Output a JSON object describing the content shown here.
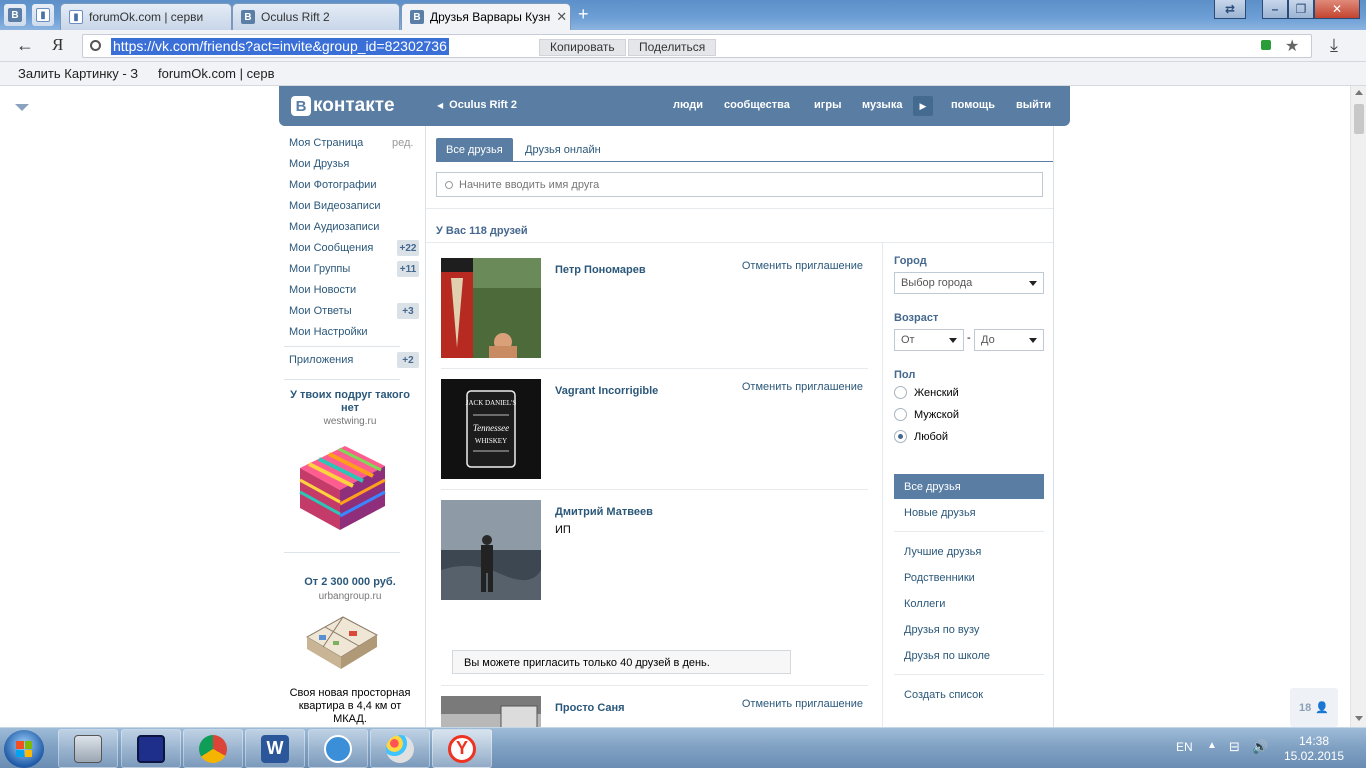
{
  "browser": {
    "tabs": [
      {
        "title": "forumOk.com | серви"
      },
      {
        "title": "Oculus Rift 2"
      },
      {
        "title": "Друзья Варвары Кузн"
      }
    ],
    "url": "https://vk.com/friends?act=invite&group_id=82302736",
    "copy_label": "Копировать",
    "share_label": "Поделиться",
    "bookmarks": [
      "Залить Картинку - З",
      "forumOk.com | серв"
    ]
  },
  "vk": {
    "logo": "контакте",
    "back_link": "Oculus Rift 2",
    "nav": [
      "люди",
      "сообщества",
      "игры",
      "музыка",
      "помощь",
      "выйти"
    ]
  },
  "sidebar": {
    "items": [
      {
        "label": "Моя Страница",
        "extra": "ред."
      },
      {
        "label": "Мои Друзья"
      },
      {
        "label": "Мои Фотографии"
      },
      {
        "label": "Мои Видеозаписи"
      },
      {
        "label": "Мои Аудиозаписи"
      },
      {
        "label": "Мои Сообщения",
        "count": "+22"
      },
      {
        "label": "Мои Группы",
        "count": "+11"
      },
      {
        "label": "Мои Новости"
      },
      {
        "label": "Мои Ответы",
        "count": "+3"
      },
      {
        "label": "Мои Настройки"
      }
    ],
    "apps": {
      "label": "Приложения",
      "count": "+2"
    },
    "ads": [
      {
        "title": "У твоих подруг такого нет",
        "domain": "westwing.ru"
      },
      {
        "title": "От 2 300 000 руб.",
        "domain": "urbangroup.ru",
        "text": "Своя новая просторная квартира в 4,4 км от МКАД."
      }
    ]
  },
  "content": {
    "tabs": [
      "Все друзья",
      "Друзья онлайн"
    ],
    "search_placeholder": "Начните вводить имя друга",
    "count_text": "У Вас 118 друзей",
    "friends": [
      {
        "name": "Петр Пономарев",
        "sub": "",
        "action": "Отменить приглашение"
      },
      {
        "name": "Vagrant Incorrigible",
        "sub": "",
        "action": "Отменить приглашение"
      },
      {
        "name": "Дмитрий Матвеев",
        "sub": "ИП",
        "action": ""
      },
      {
        "name": "Просто Саня",
        "sub": "",
        "action": "Отменить приглашение"
      }
    ],
    "limit_notice": "Вы можете пригласить только 40 друзей в день.",
    "jack_label_top": "JACK DANIEL'S",
    "jack_label_mid": "Tennessee",
    "jack_label_bot": "WHISKEY"
  },
  "filters": {
    "city_label": "Город",
    "city_value": "Выбор города",
    "age_label": "Возраст",
    "age_from": "От",
    "age_to": "До",
    "age_dash": "-",
    "sex_label": "Пол",
    "sex_options": [
      {
        "label": "Женский",
        "checked": false
      },
      {
        "label": "Мужской",
        "checked": false
      },
      {
        "label": "Любой",
        "checked": true
      }
    ],
    "lists_primary": [
      "Все друзья",
      "Новые друзья"
    ],
    "lists_secondary": [
      "Лучшие друзья",
      "Родственники",
      "Коллеги",
      "Друзья по вузу",
      "Друзья по школе"
    ],
    "create_list": "Создать список"
  },
  "notif_count": "18",
  "taskbar": {
    "lang": "EN",
    "time": "14:38",
    "date": "15.02.2015"
  }
}
